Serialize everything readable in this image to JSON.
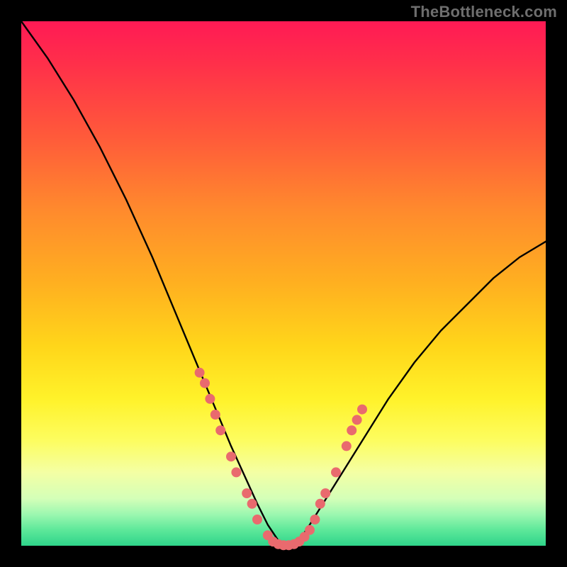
{
  "watermark": "TheBottleneck.com",
  "chart_data": {
    "type": "line",
    "title": "",
    "xlabel": "",
    "ylabel": "",
    "xlim": [
      0,
      100
    ],
    "ylim": [
      0,
      100
    ],
    "grid": false,
    "legend": false,
    "series": [
      {
        "name": "bottleneck-curve",
        "x": [
          0,
          5,
          10,
          15,
          20,
          25,
          30,
          35,
          40,
          45,
          47,
          49,
          51,
          53,
          55,
          60,
          65,
          70,
          75,
          80,
          85,
          90,
          95,
          100
        ],
        "y": [
          100,
          93,
          85,
          76,
          66,
          55,
          43,
          31,
          19,
          8,
          4,
          1,
          0,
          1,
          4,
          12,
          20,
          28,
          35,
          41,
          46,
          51,
          55,
          58
        ]
      }
    ],
    "markers": {
      "name": "highlighted-points",
      "color": "#e96a6e",
      "points": [
        {
          "x": 34,
          "y": 33
        },
        {
          "x": 35,
          "y": 31
        },
        {
          "x": 36,
          "y": 28
        },
        {
          "x": 37,
          "y": 25
        },
        {
          "x": 38,
          "y": 22
        },
        {
          "x": 40,
          "y": 17
        },
        {
          "x": 41,
          "y": 14
        },
        {
          "x": 43,
          "y": 10
        },
        {
          "x": 44,
          "y": 8
        },
        {
          "x": 45,
          "y": 5
        },
        {
          "x": 47,
          "y": 2
        },
        {
          "x": 48,
          "y": 0.8
        },
        {
          "x": 49,
          "y": 0.3
        },
        {
          "x": 50,
          "y": 0.1
        },
        {
          "x": 51,
          "y": 0.1
        },
        {
          "x": 52,
          "y": 0.3
        },
        {
          "x": 53,
          "y": 0.8
        },
        {
          "x": 54,
          "y": 1.7
        },
        {
          "x": 55,
          "y": 3
        },
        {
          "x": 56,
          "y": 5
        },
        {
          "x": 57,
          "y": 8
        },
        {
          "x": 58,
          "y": 10
        },
        {
          "x": 60,
          "y": 14
        },
        {
          "x": 62,
          "y": 19
        },
        {
          "x": 63,
          "y": 22
        },
        {
          "x": 64,
          "y": 24
        },
        {
          "x": 65,
          "y": 26
        }
      ]
    }
  }
}
